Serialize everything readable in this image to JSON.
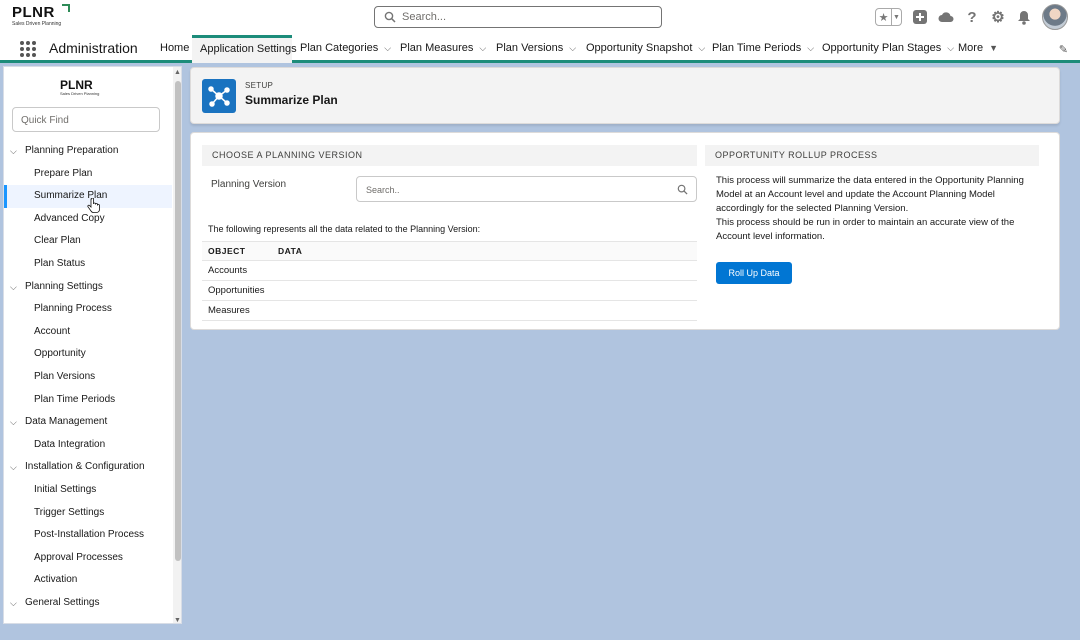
{
  "header": {
    "logo_text": "PLNR",
    "logo_tagline": "Sales Driven Planning",
    "search_placeholder": "Search..."
  },
  "nav": {
    "app_name": "Administration",
    "items": [
      {
        "label": "Home",
        "dropdown": false
      },
      {
        "label": "Application Settings",
        "dropdown": false,
        "active": true
      },
      {
        "label": "Plan Categories",
        "dropdown": true
      },
      {
        "label": "Plan Measures",
        "dropdown": true
      },
      {
        "label": "Plan Versions",
        "dropdown": true
      },
      {
        "label": "Opportunity Snapshot",
        "dropdown": true
      },
      {
        "label": "Plan Time Periods",
        "dropdown": true
      },
      {
        "label": "Opportunity Plan Stages",
        "dropdown": true
      },
      {
        "label": "More",
        "dropdown": true
      }
    ]
  },
  "sidebar": {
    "logo_text": "PLNR",
    "logo_tagline": "Sales Driven Planning",
    "quick_find_placeholder": "Quick Find",
    "tree": [
      {
        "type": "section",
        "label": "Planning Preparation"
      },
      {
        "type": "item",
        "label": "Prepare Plan"
      },
      {
        "type": "item",
        "label": "Summarize Plan",
        "selected": true
      },
      {
        "type": "item",
        "label": "Advanced Copy"
      },
      {
        "type": "item",
        "label": "Clear Plan"
      },
      {
        "type": "item",
        "label": "Plan Status"
      },
      {
        "type": "section",
        "label": "Planning Settings"
      },
      {
        "type": "item",
        "label": "Planning Process"
      },
      {
        "type": "item",
        "label": "Account"
      },
      {
        "type": "item",
        "label": "Opportunity"
      },
      {
        "type": "item",
        "label": "Plan Versions"
      },
      {
        "type": "item",
        "label": "Plan Time Periods"
      },
      {
        "type": "section",
        "label": "Data Management"
      },
      {
        "type": "item",
        "label": "Data Integration"
      },
      {
        "type": "section",
        "label": "Installation & Configuration"
      },
      {
        "type": "item",
        "label": "Initial Settings"
      },
      {
        "type": "item",
        "label": "Trigger Settings"
      },
      {
        "type": "item",
        "label": "Post-Installation Process"
      },
      {
        "type": "item",
        "label": "Approval Processes"
      },
      {
        "type": "item",
        "label": "Activation"
      },
      {
        "type": "section",
        "label": "General Settings"
      }
    ]
  },
  "page_header": {
    "eyebrow": "SETUP",
    "title": "Summarize Plan"
  },
  "left_section": {
    "heading": "CHOOSE A PLANNING VERSION",
    "field_label": "Planning Version",
    "field_placeholder": "Search..",
    "intro": "The following represents all the data related to the Planning Version:",
    "columns": [
      "OBJECT",
      "DATA"
    ],
    "rows": [
      {
        "object": "Accounts",
        "data": ""
      },
      {
        "object": "Opportunities",
        "data": ""
      },
      {
        "object": "Measures",
        "data": ""
      }
    ]
  },
  "right_section": {
    "heading": "OPPORTUNITY ROLLUP PROCESS",
    "desc_1": "This process will summarize the data entered in the Opportunity Planning Model at an Account level and update the Account Planning Model accordingly for the selected Planning Version.",
    "desc_2": "This process should be run in order to maintain an accurate view of the Account level information.",
    "button_label": "Roll Up Data"
  },
  "colors": {
    "brand_teal": "#1c8c7a",
    "button_blue": "#0176d3",
    "setup_icon_blue": "#1a73c0",
    "background": "#b0c4df"
  }
}
